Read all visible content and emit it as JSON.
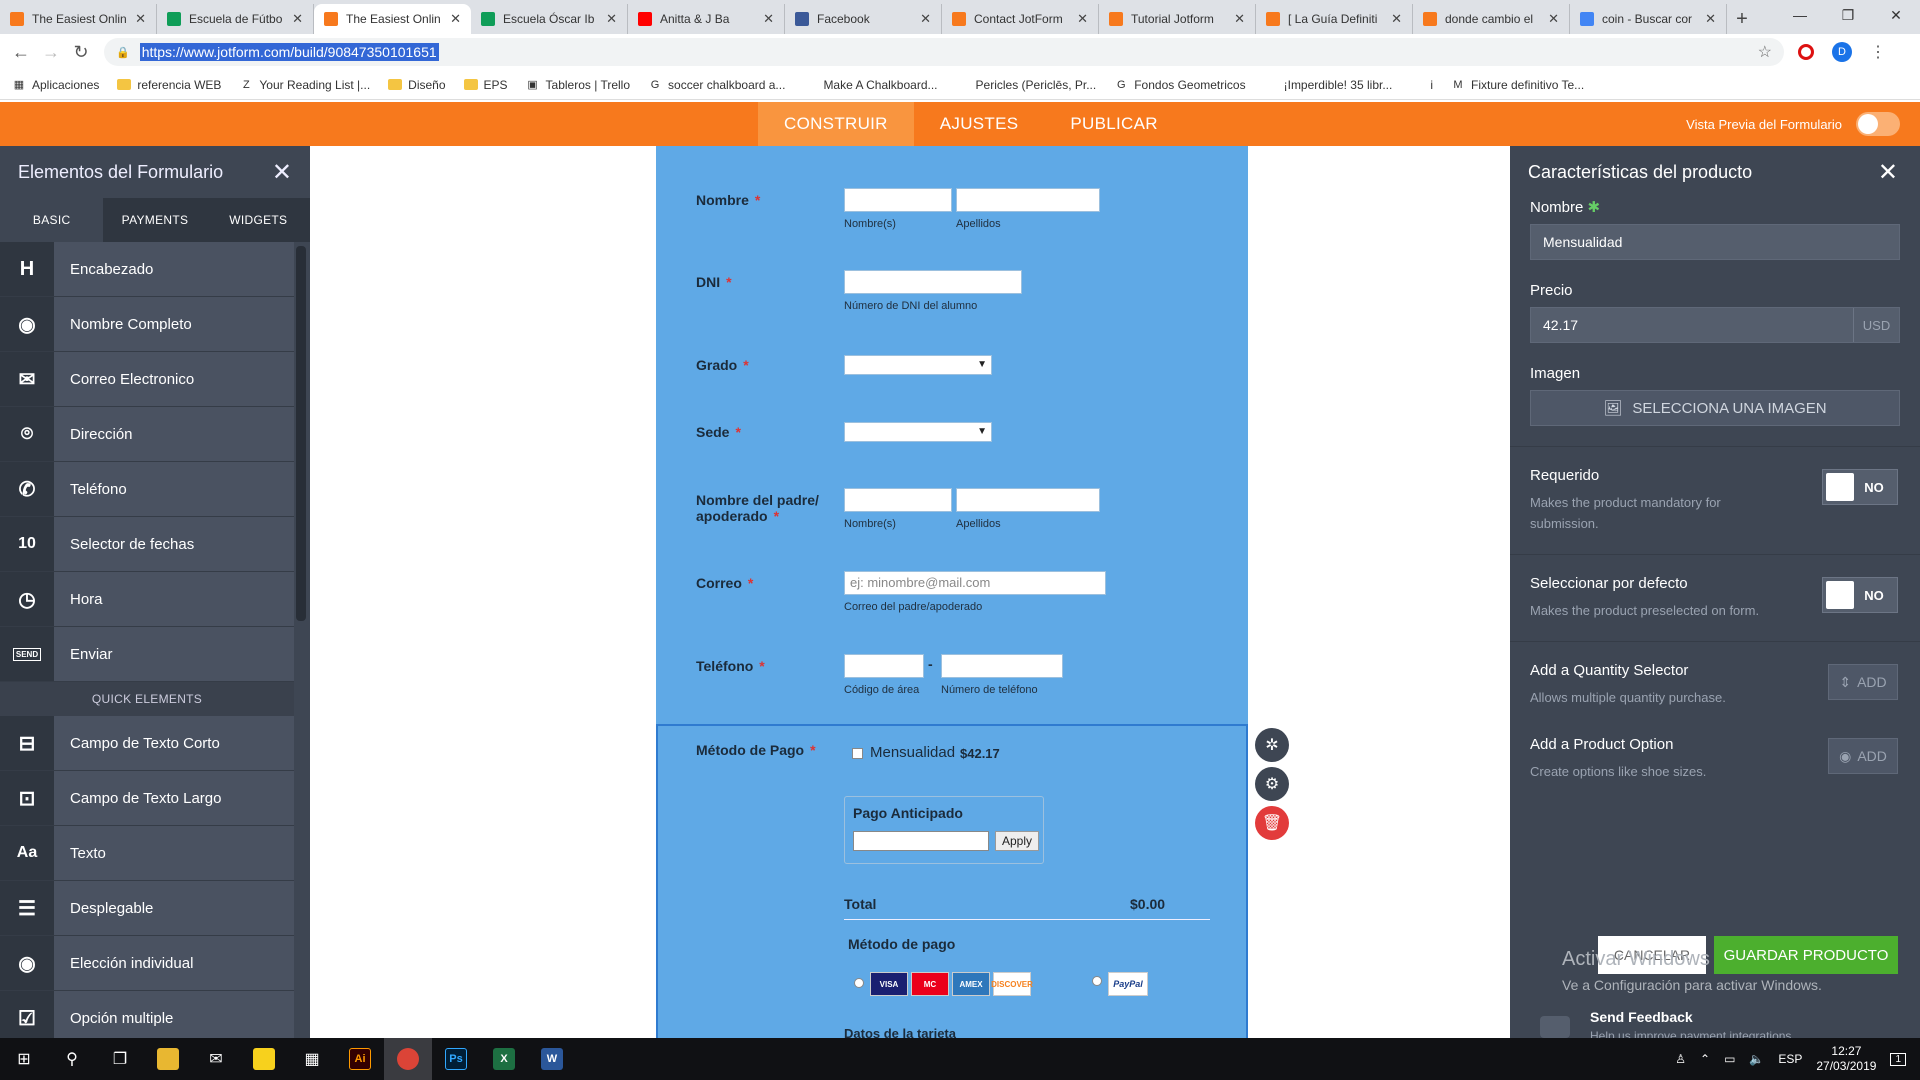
{
  "browser": {
    "tabs": [
      {
        "title": "The Easiest Onlin",
        "favicon": "jotform-icon",
        "color": "#f7791d"
      },
      {
        "title": "Escuela de Fútbo",
        "favicon": "sheets-icon",
        "color": "#0f9d58"
      },
      {
        "title": "The Easiest Onlin",
        "favicon": "jotform-icon",
        "color": "#f7791d",
        "active": true
      },
      {
        "title": "Escuela Óscar Ib",
        "favicon": "sheets-icon",
        "color": "#0f9d58"
      },
      {
        "title": "Anitta & J Ba",
        "favicon": "youtube-icon",
        "color": "#ff0000"
      },
      {
        "title": "Facebook",
        "favicon": "facebook-icon",
        "color": "#3b5998"
      },
      {
        "title": "Contact JotForm",
        "favicon": "jotform-icon",
        "color": "#f7791d"
      },
      {
        "title": "Tutorial Jotform",
        "favicon": "search-icon",
        "color": "#f7791d"
      },
      {
        "title": "[ La Guía Definiti",
        "favicon": "search-icon",
        "color": "#f7791d"
      },
      {
        "title": "donde cambio el",
        "favicon": "jotform-icon",
        "color": "#f7791d"
      },
      {
        "title": "coin - Buscar cor",
        "favicon": "google-icon",
        "color": "#4285f4"
      }
    ],
    "url": "https://www.jotform.com/build/90847350101651",
    "bookmarks": [
      {
        "label": "Aplicaciones",
        "icon": "apps-icon"
      },
      {
        "label": "referencia WEB",
        "icon": "folder-icon"
      },
      {
        "label": "Your Reading List |...",
        "icon": "z-icon"
      },
      {
        "label": "Diseño",
        "icon": "folder-icon"
      },
      {
        "label": "EPS",
        "icon": "folder-icon"
      },
      {
        "label": "Tableros | Trello",
        "icon": "trello-icon"
      },
      {
        "label": "soccer chalkboard a...",
        "icon": "google-icon"
      },
      {
        "label": "Make A Chalkboard...",
        "icon": "link-icon"
      },
      {
        "label": "Pericles (Periclēs, Pr...",
        "icon": "link-icon"
      },
      {
        "label": "Fondos Geometricos",
        "icon": "google-icon"
      },
      {
        "label": "¡Imperdible! 35 libr...",
        "icon": "link-icon"
      },
      {
        "label": "i",
        "icon": "link-icon"
      },
      {
        "label": "Fixture definitivo Te...",
        "icon": "gmail-icon"
      }
    ]
  },
  "header": {
    "nav": [
      "CONSTRUIR",
      "AJUSTES",
      "PUBLICAR"
    ],
    "preview_label": "Vista Previa del Formulario"
  },
  "left_panel": {
    "title": "Elementos del Formulario",
    "tabs": [
      "BASIC",
      "PAYMENTS",
      "WIDGETS"
    ],
    "items": [
      {
        "label": "Encabezado",
        "icon": "heading-icon",
        "glyph": "H"
      },
      {
        "label": "Nombre Completo",
        "icon": "user-icon",
        "glyph": "◉"
      },
      {
        "label": "Correo Electronico",
        "icon": "envelope-icon",
        "glyph": "✉"
      },
      {
        "label": "Dirección",
        "icon": "location-pin-icon",
        "glyph": "⌾"
      },
      {
        "label": "Teléfono",
        "icon": "phone-icon",
        "glyph": "✆"
      },
      {
        "label": "Selector de fechas",
        "icon": "calendar-icon",
        "glyph": "10"
      },
      {
        "label": "Hora",
        "icon": "clock-icon",
        "glyph": "◷"
      },
      {
        "label": "Enviar",
        "icon": "send-button-icon",
        "glyph": "SEND"
      }
    ],
    "quick_title": "QUICK ELEMENTS",
    "quick_items": [
      {
        "label": "Campo de Texto Corto",
        "icon": "short-text-icon",
        "glyph": "⊟"
      },
      {
        "label": "Campo de Texto Largo",
        "icon": "long-text-icon",
        "glyph": "⊡"
      },
      {
        "label": "Texto",
        "icon": "text-icon",
        "glyph": "Aa"
      },
      {
        "label": "Desplegable",
        "icon": "dropdown-icon",
        "glyph": "☰"
      },
      {
        "label": "Elección individual",
        "icon": "radio-icon",
        "glyph": "◉"
      },
      {
        "label": "Opción multiple",
        "icon": "checkbox-icon",
        "glyph": "☑"
      }
    ]
  },
  "form": {
    "nombre": {
      "label": "Nombre",
      "sub1": "Nombre(s)",
      "sub2": "Apellidos"
    },
    "dni": {
      "label": "DNI",
      "sub": "Número de DNI del alumno"
    },
    "grado": {
      "label": "Grado"
    },
    "sede": {
      "label": "Sede"
    },
    "padre": {
      "label1": "Nombre del padre/",
      "label2": "apoderado",
      "sub1": "Nombre(s)",
      "sub2": "Apellidos"
    },
    "correo": {
      "label": "Correo",
      "placeholder": "ej: minombre@mail.com",
      "sub": "Correo del padre/apoderado"
    },
    "telefono": {
      "label": "Teléfono",
      "sub1": "Código de área",
      "sub2": "Número de teléfono",
      "dash": "-"
    },
    "pago": {
      "label": "Método de Pago",
      "product": "Mensualidad",
      "price": "$42.17",
      "coupon_title": "Pago Anticipado",
      "apply": "Apply",
      "total_label": "Total",
      "total_value": "$0.00",
      "method_title": "Método de pago",
      "cards": [
        "VISA",
        "MC",
        "AMEX",
        "DISCOVER"
      ],
      "paypal": "PayPal",
      "card_data": "Datos de la tarjeta"
    },
    "required_mark": "*"
  },
  "right_panel": {
    "title": "Características del producto",
    "name_label": "Nombre",
    "name_value": "Mensualidad",
    "price_label": "Precio",
    "price_value": "42.17",
    "currency": "USD",
    "image_label": "Imagen",
    "image_button": "SELECCIONA UNA IMAGEN",
    "required": {
      "title": "Requerido",
      "desc": "Makes the product mandatory for submission.",
      "state": "NO"
    },
    "default": {
      "title": "Seleccionar por defecto",
      "desc": "Makes the product preselected on form.",
      "state": "NO"
    },
    "quantity": {
      "title": "Add a Quantity Selector",
      "desc": "Allows multiple quantity purchase.",
      "button": "ADD"
    },
    "option": {
      "title": "Add a Product Option",
      "desc": "Create options like shoe sizes.",
      "button": "ADD"
    },
    "cancel": "CANCELAR",
    "save": "GUARDAR PRODUCTO",
    "feedback": "Send Feedback",
    "feedback_sub": "Help us improve payment integrations"
  },
  "watermark": {
    "line1": "Activar Windows",
    "line2": "Ve a Configuración para activar Windows."
  },
  "taskbar": {
    "lang": "ESP",
    "time": "12:27",
    "date": "27/03/2019",
    "notifications": "1"
  }
}
